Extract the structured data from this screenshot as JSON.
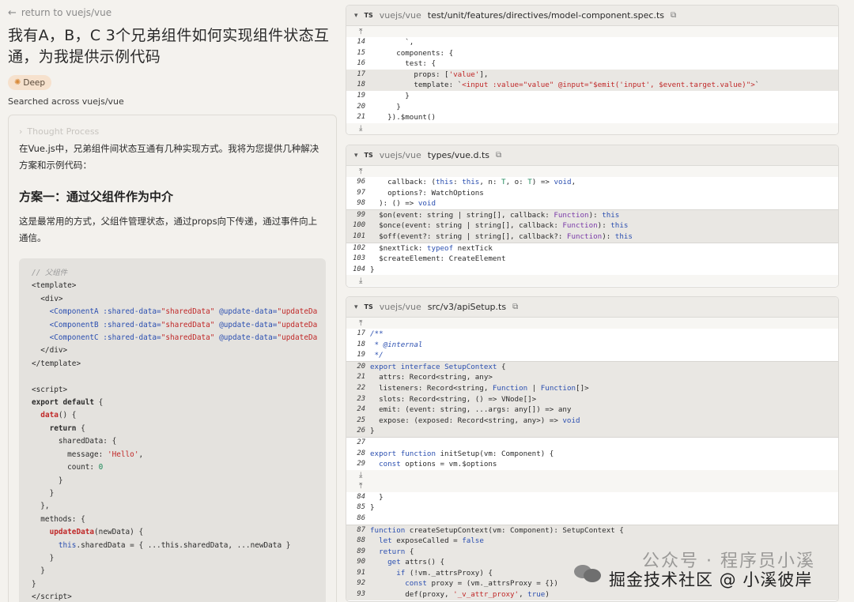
{
  "nav": {
    "back_label": "return to vuejs/vue"
  },
  "question": "我有A，B，C 3个兄弟组件如何实现组件状态互通，为我提供示例代码",
  "badge": {
    "label": "Deep",
    "icon": "lightbulb-icon"
  },
  "searched_label": "Searched across vuejs/vue",
  "answer": {
    "thought_label": "Thought Process",
    "intro": "在Vue.js中，兄弟组件间状态互通有几种实现方式。我将为您提供几种解决方案和示例代码：",
    "section_title": "方案一：通过父组件作为中介",
    "section_desc": "这是最常用的方式，父组件管理状态，通过props向下传递，通过事件向上通信。"
  },
  "files": [
    {
      "repo": "vuejs/vue",
      "path": "test/unit/features/directives/model-component.spec.ts",
      "lang": "TS"
    },
    {
      "repo": "vuejs/vue",
      "path": "types/vue.d.ts",
      "lang": "TS"
    },
    {
      "repo": "vuejs/vue",
      "path": "src/v3/apiSetup.ts",
      "lang": "TS"
    }
  ],
  "watermark": {
    "line1": "公众号 · 程序员小溪",
    "line2": "掘金技术社区 @ 小溪彼岸"
  }
}
